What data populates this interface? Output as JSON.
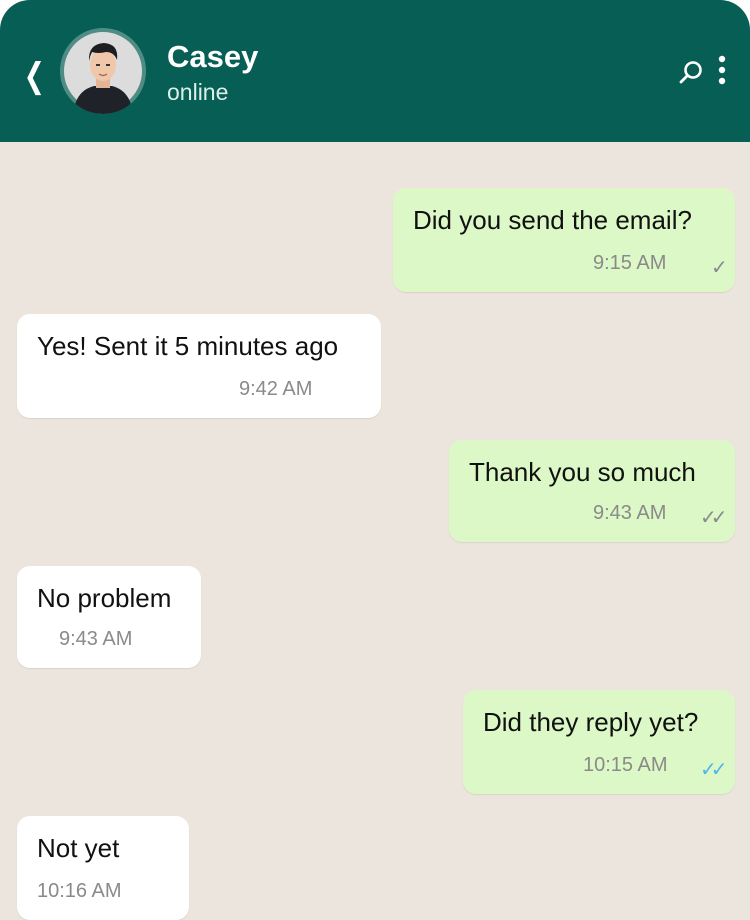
{
  "header": {
    "back_icon": "chevron-left-icon",
    "contact_name": "Casey",
    "contact_status": "online",
    "search_icon": "search-icon",
    "more_icon": "more-vertical-icon",
    "background": "#075e54"
  },
  "chat": {
    "background": "#ece5dd",
    "outgoing_color": "#dcf8c6",
    "incoming_color": "#ffffff",
    "read_tick_color": "#4fb6ec",
    "messages": [
      {
        "direction": "outgoing",
        "text": "Did you send the email?",
        "time": "9:15 AM",
        "tick": "✓",
        "status": "sent"
      },
      {
        "direction": "incoming",
        "text": "Yes! Sent it 5 minutes ago",
        "time": "9:42 AM"
      },
      {
        "direction": "outgoing",
        "text": "Thank you so much",
        "time": "9:43 AM",
        "tick": "✓✓",
        "status": "delivered"
      },
      {
        "direction": "incoming",
        "text": "No problem",
        "time": "9:43 AM"
      },
      {
        "direction": "outgoing",
        "text": "Did they reply yet?",
        "time": "10:15 AM",
        "tick": "✓✓",
        "status": "read"
      },
      {
        "direction": "incoming",
        "text": "Not yet",
        "time": "10:16 AM"
      }
    ]
  }
}
